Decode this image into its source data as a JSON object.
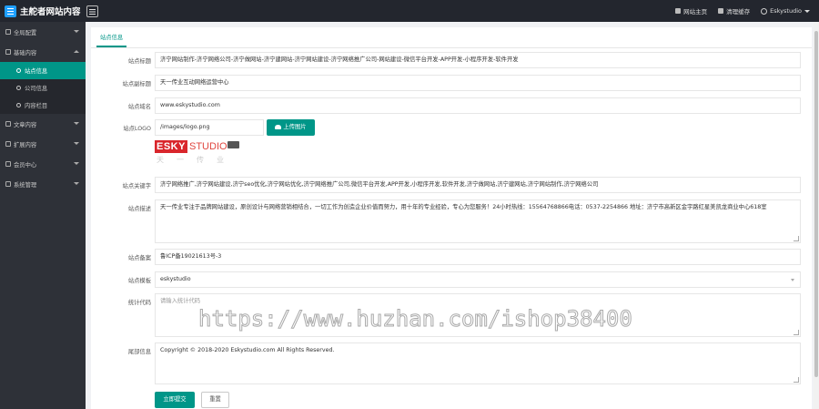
{
  "header": {
    "title": "主舵者网站内容",
    "links": [
      {
        "label": "网站主页",
        "icon": "home-icon"
      },
      {
        "label": "清理缓存",
        "icon": "trash-icon"
      }
    ],
    "user": "Eskystudio"
  },
  "sidebar": {
    "items": [
      {
        "label": "全局配置",
        "icon": "globe-icon"
      },
      {
        "label": "基础内容",
        "icon": "layers-icon"
      },
      {
        "label": "站点信息",
        "icon": "gear-icon"
      },
      {
        "label": "公司信息",
        "icon": "gear-icon"
      },
      {
        "label": "内容栏目",
        "icon": "list-icon"
      },
      {
        "label": "文章内容",
        "icon": "file-icon"
      },
      {
        "label": "扩展内容",
        "icon": "tool-icon"
      },
      {
        "label": "会员中心",
        "icon": "user-icon"
      },
      {
        "label": "系统管理",
        "icon": "settings-icon"
      }
    ]
  },
  "tab": "站点信息",
  "form": {
    "title": {
      "label": "站点标题",
      "value": "济宁网站制作-济宁网络公司-济宁做网站-济宁建网站-济宁网站建设-济宁网络推广公司-网站建设-微信平台开发-APP开发-小程序开发-软件开发"
    },
    "subtitle": {
      "label": "站点副标题",
      "value": "天一传业互动网络运营中心"
    },
    "domain": {
      "label": "站点域名",
      "value": "www.eskystudio.com"
    },
    "logo": {
      "label": "站点LOGO",
      "value": "/images/logo.png",
      "upload_button": "上传图片",
      "logo_text_red": "ESKY",
      "logo_text": "STUDIO",
      "logo_sub": "天一传业"
    },
    "keywords": {
      "label": "站点关键字",
      "value": "济宁网络推广,济宁网站建设,济宁seo优化,济宁网站优化,济宁网络推广公司,微信平台开发,APP开发,小程序开发,软件开发,济宁做网站,济宁建网站,济宁网站制作,济宁网络公司"
    },
    "description": {
      "label": "站点描述",
      "value": "天一传业专注于品牌网站建设，原创设计与网络营销相结合，一切工作为创造企业价值而努力，用十年的专业经验，专心为您服务！24小时热线：15564768866电话：0537-2254866   地址：济宁市高新区金宇路红星美凯龙商业中心618室"
    },
    "icp": {
      "label": "站点备案",
      "value": "鲁ICP备19021613号-3"
    },
    "template": {
      "label": "站点模板",
      "value": "eskystudio"
    },
    "stats": {
      "label": "统计代码",
      "placeholder": "请输入统计代码"
    },
    "footer": {
      "label": "尾部信息",
      "value": "Copyright © 2018-2020 Eskystudio.com All Rights Reserved."
    }
  },
  "buttons": {
    "submit": "立即提交",
    "reset": "重置"
  },
  "watermark": "https://www.huzhan.com/ishop38400",
  "colors": {
    "accent": "#009688",
    "topbar": "#23262e",
    "sidebar": "#2e3138"
  }
}
